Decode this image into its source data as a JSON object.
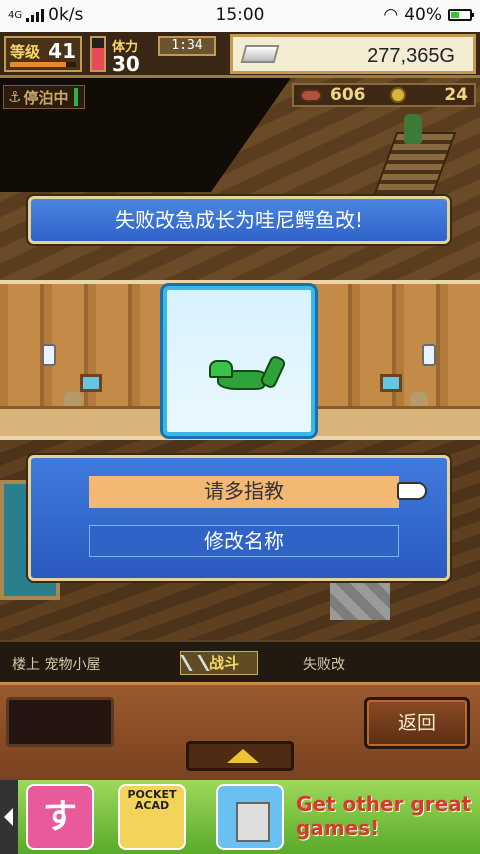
{
  "status_bar": {
    "network": "4G",
    "speed": "0k/s",
    "time": "15:00",
    "battery": "40%",
    "battery_level": 0.4
  },
  "hud": {
    "level_label": "等级",
    "level": "41",
    "level_progress": 0.85,
    "stamina_label": "体力",
    "stamina": "30",
    "stamina_gauge": 0.7,
    "clock": "1:34",
    "gold": "277,365G",
    "dock_status": "停泊中",
    "meat": "606",
    "coins": "24"
  },
  "dialog": {
    "message": "失败改急成长为哇尼鳄鱼改!"
  },
  "menu": {
    "option_selected": "请多指教",
    "option_rename": "修改名称"
  },
  "breadcrumb": {
    "location": "楼上 宠物小屋",
    "battle": "战斗",
    "pet_name": "失败改"
  },
  "panel": {
    "back_label": "返回"
  },
  "ad": {
    "app1_text": "すし",
    "app2_text": "POCKET ACAD",
    "cta": "Get other great games!"
  },
  "colors": {
    "dialog_blue": "#3f7bdc",
    "selected_option": "#f2b874",
    "gold_text": "#f7d66a"
  }
}
